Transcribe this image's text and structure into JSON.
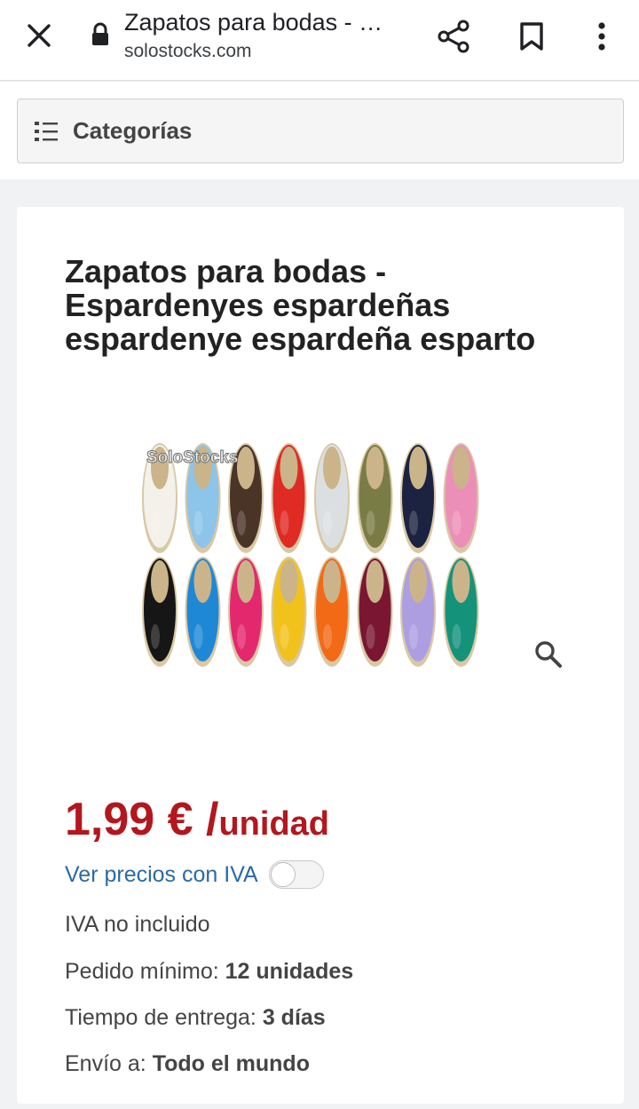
{
  "browser": {
    "title": "Zapatos para bodas - …",
    "url": "solostocks.com",
    "icons": [
      "close-icon",
      "lock-icon",
      "share-icon",
      "bookmark-icon",
      "more-vert-icon"
    ]
  },
  "categories": {
    "label": "Categorías",
    "icon": "list-icon"
  },
  "product": {
    "title": "Zapatos para bodas - Espardenyes espardeñas espardenye espardeña esparto",
    "image_watermark": "SoloStocks",
    "price_amount": "1,99 € /",
    "price_unit": "unidad",
    "iva_toggle_label": "Ver precios con IVA",
    "iva_toggle_on": false,
    "iva_note": "IVA no incluido",
    "min_order_label": "Pedido mínimo:",
    "min_order_value": "12 unidades",
    "delivery_label": "Tiempo de entrega:",
    "delivery_value": "3 días",
    "shipping_label": "Envío a:",
    "shipping_value": "Todo el mundo"
  },
  "colors": {
    "price": "#b3171e",
    "link": "#2a6aa5",
    "shoe_row1": [
      "#f4f1ea",
      "#8cc4ea",
      "#4a3428",
      "#e02a24",
      "#dcdfe2",
      "#7a7c45",
      "#1c2340",
      "#ec8fb8"
    ],
    "shoe_row2": [
      "#161616",
      "#1f88d6",
      "#e4286e",
      "#f2c21c",
      "#f26a16",
      "#7a1632",
      "#ad9ee2",
      "#15927a"
    ]
  }
}
